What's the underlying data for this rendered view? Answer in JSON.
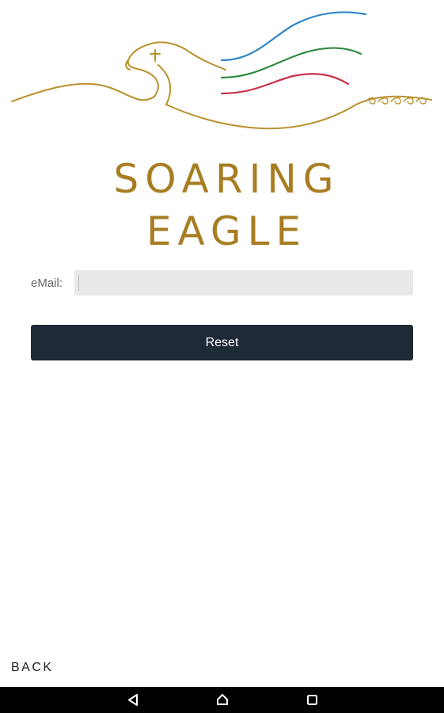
{
  "brand": {
    "line1": "SOARING",
    "line2": "EAGLE",
    "logo_signature": "aeaa",
    "logo_colors": {
      "gold": "#b8912e",
      "blue": "#2f86c6",
      "green": "#2e8b3e",
      "red": "#c8324a"
    },
    "text_color": "#a87d22"
  },
  "form": {
    "email_label": "eMail:",
    "email_value": "",
    "email_placeholder": "",
    "reset_label": "Reset",
    "button_color": "#1e2a35"
  },
  "footer": {
    "back_label": "BACK"
  },
  "system_nav": {
    "icons": [
      "back-triangle-icon",
      "home-icon",
      "recents-icon"
    ],
    "bar_color": "#000000"
  }
}
